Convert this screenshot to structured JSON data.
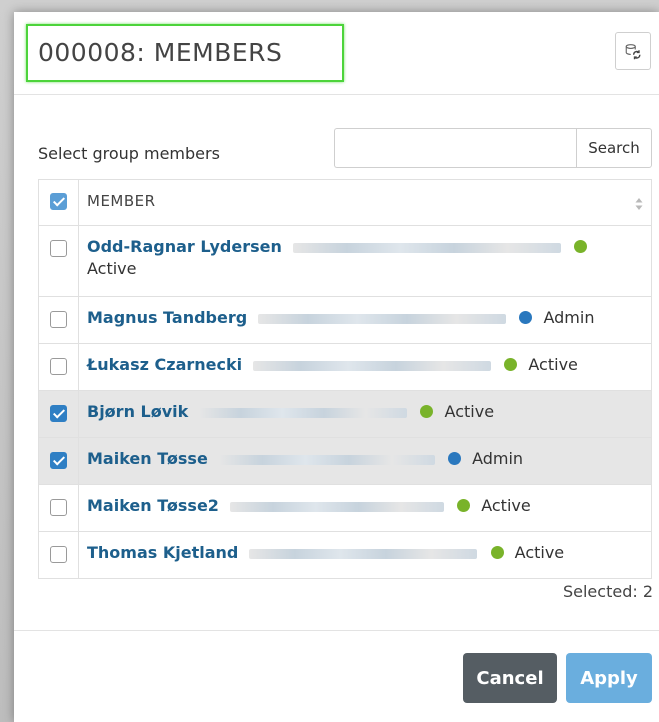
{
  "header": {
    "title": "000008: MEMBERS"
  },
  "search": {
    "label": "Select group members",
    "placeholder": "",
    "value": "",
    "button_label": "Search"
  },
  "table": {
    "column_title": "MEMBER",
    "rows": [
      {
        "name": "Odd-Ragnar Lydersen",
        "role": "Active",
        "status_color": "#79b32a",
        "checked": false
      },
      {
        "name": "Magnus Tandberg",
        "role": "Admin",
        "status_color": "#2a78be",
        "checked": false
      },
      {
        "name": "Łukasz Czarnecki",
        "role": "Active",
        "status_color": "#79b32a",
        "checked": false
      },
      {
        "name": "Bjørn Løvik",
        "role": "Active",
        "status_color": "#79b32a",
        "checked": true
      },
      {
        "name": "Maiken Tøsse",
        "role": "Admin",
        "status_color": "#2a78be",
        "checked": true
      },
      {
        "name": "Maiken Tøsse2",
        "role": "Active",
        "status_color": "#79b32a",
        "checked": false
      },
      {
        "name": "Thomas Kjetland",
        "role": "Active",
        "status_color": "#79b32a",
        "checked": false
      }
    ]
  },
  "selected_text": "Selected: 2",
  "footer": {
    "cancel_label": "Cancel",
    "apply_label": "Apply"
  },
  "colors": {
    "highlight_border": "#4cd43a",
    "name_link": "#1d5f8c",
    "active_dot": "#79b32a",
    "admin_dot": "#2a78be",
    "apply_button": "#6aaede",
    "cancel_button": "#555d63"
  },
  "icons": {
    "refresh": "refresh-icon",
    "sort": "sort-icon"
  }
}
